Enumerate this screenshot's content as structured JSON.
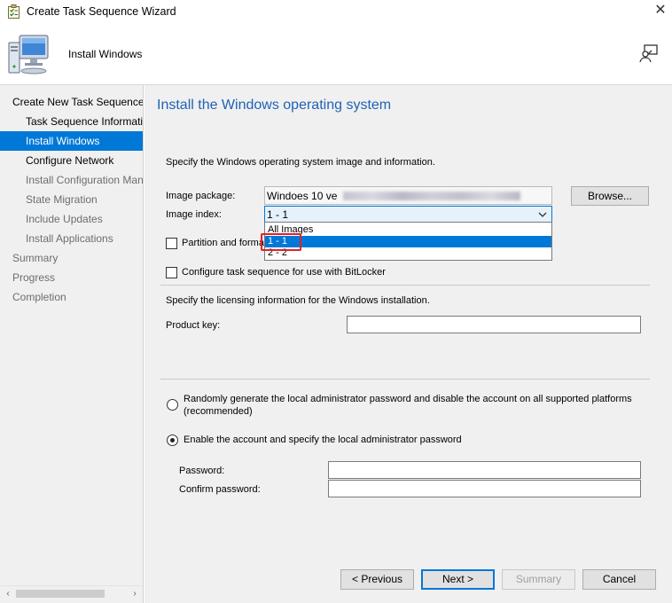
{
  "window": {
    "title": "Create Task Sequence Wizard",
    "close_glyph": "✕"
  },
  "banner": {
    "heading": "Install Windows"
  },
  "sidebar": {
    "items": [
      {
        "label": "Create New Task Sequence",
        "state": "normal"
      },
      {
        "label": "Task Sequence Information",
        "state": "normal"
      },
      {
        "label": "Install Windows",
        "state": "active"
      },
      {
        "label": "Configure Network",
        "state": "normal"
      },
      {
        "label": "Install Configuration Manager",
        "state": "dim"
      },
      {
        "label": "State Migration",
        "state": "dim"
      },
      {
        "label": "Include Updates",
        "state": "dim"
      },
      {
        "label": "Install Applications",
        "state": "dim"
      },
      {
        "label": "Summary",
        "state": "dim"
      },
      {
        "label": "Progress",
        "state": "dim"
      },
      {
        "label": "Completion",
        "state": "dim"
      }
    ],
    "scroll_left": "‹",
    "scroll_right": "›"
  },
  "main": {
    "title": "Install the Windows operating system",
    "intro": "Specify the Windows operating system image and information.",
    "image_package_label": "Image package:",
    "image_package_value": "Windoes 10 ve",
    "browse_label": "Browse...",
    "image_index_label": "Image index:",
    "image_index_value": "1 - 1",
    "dropdown_options": [
      "All Images",
      "1 - 1",
      "2 - 2"
    ],
    "dropdown_selected": "1 - 1",
    "partition_label": "Partition and format",
    "bitlocker_label": "Configure task sequence for use with BitLocker",
    "licensing_intro": "Specify the licensing information for the Windows installation.",
    "product_key_label": "Product key:",
    "product_key_value": "",
    "radio_random_label_line1": "Randomly generate the local administrator password and disable the account on all supported platforms",
    "radio_random_label_line2": "(recommended)",
    "radio_enable_label": "Enable the account and specify the local administrator password",
    "password_label": "Password:",
    "confirm_password_label": "Confirm password:",
    "password_value": "",
    "confirm_password_value": ""
  },
  "footer": {
    "previous_label": "< Previous",
    "next_label": "Next >",
    "summary_label": "Summary",
    "cancel_label": "Cancel"
  },
  "colors": {
    "accent": "#0078d7",
    "title_blue": "#1f62b6",
    "highlight_red": "#e0212d"
  }
}
